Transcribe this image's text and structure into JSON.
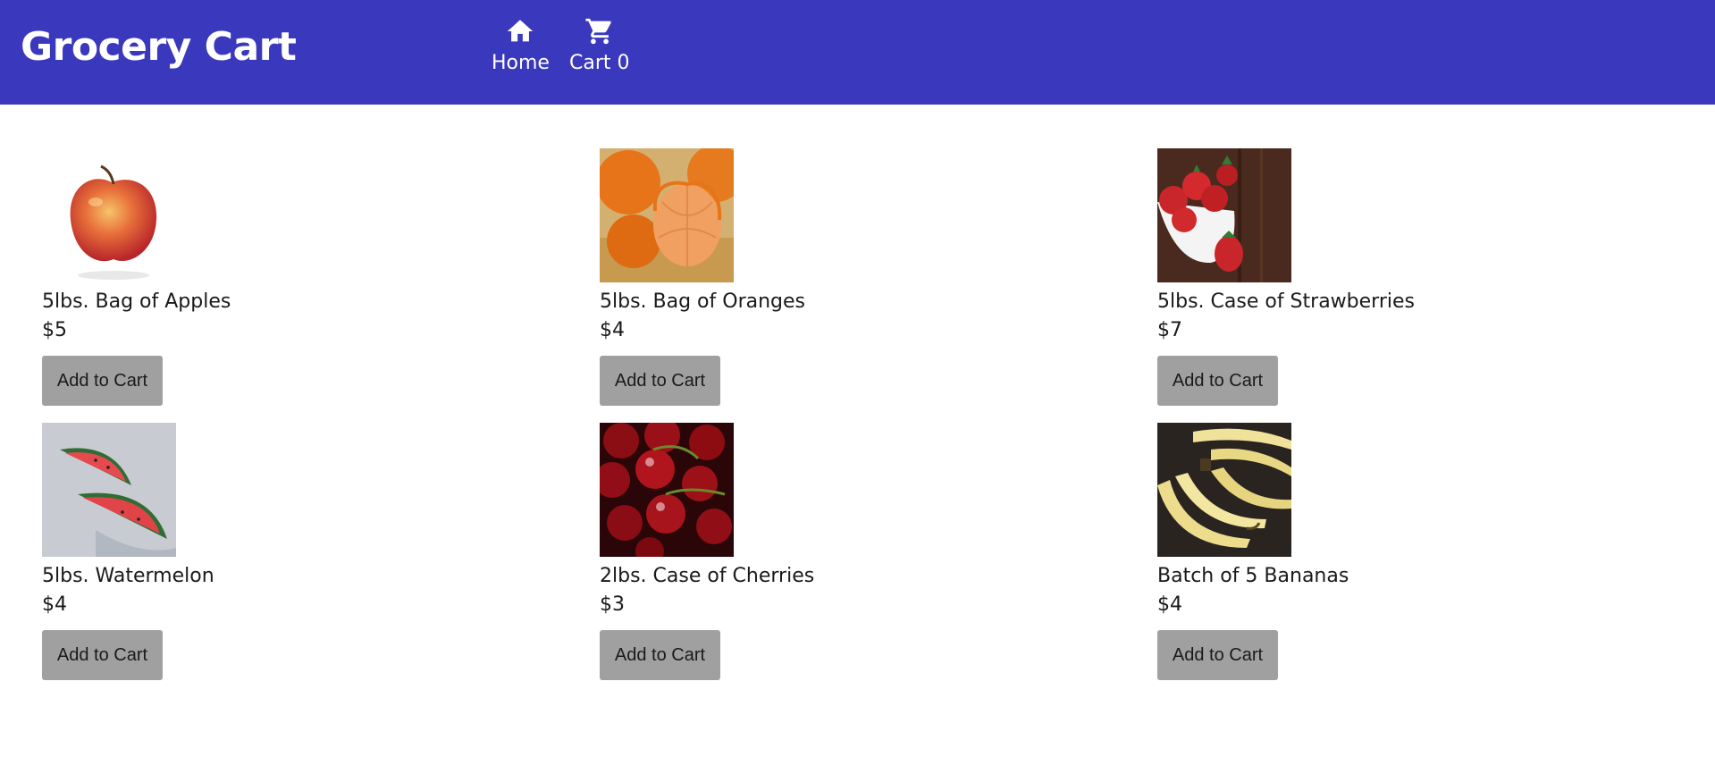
{
  "header": {
    "title": "Grocery Cart",
    "bg_color": "#3a38bc",
    "nav": [
      {
        "label": "Home",
        "icon": "home-icon"
      },
      {
        "label": "Cart",
        "count": "0",
        "icon": "shopping-cart-icon"
      }
    ]
  },
  "products": [
    {
      "name": "5lbs. Bag of Apples",
      "price": "$5",
      "button": "Add to Cart",
      "image": "apple"
    },
    {
      "name": "5lbs. Bag of Oranges",
      "price": "$4",
      "button": "Add to Cart",
      "image": "oranges"
    },
    {
      "name": "5lbs. Case of Strawberries",
      "price": "$7",
      "button": "Add to Cart",
      "image": "strawberries"
    },
    {
      "name": "5lbs. Watermelon",
      "price": "$4",
      "button": "Add to Cart",
      "image": "watermelon"
    },
    {
      "name": "2lbs. Case of Cherries",
      "price": "$3",
      "button": "Add to Cart",
      "image": "cherries"
    },
    {
      "name": "Batch of 5 Bananas",
      "price": "$4",
      "button": "Add to Cart",
      "image": "bananas"
    }
  ],
  "colors": {
    "button": "#a0a0a0",
    "text": "#1a1a1a"
  }
}
